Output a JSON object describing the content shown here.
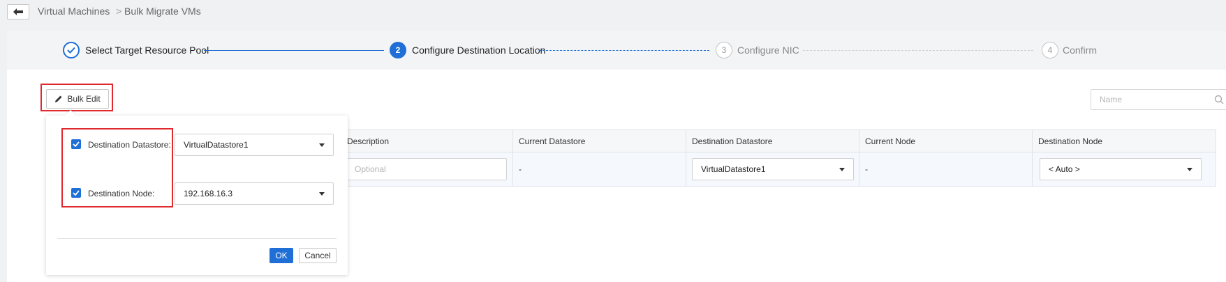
{
  "breadcrumb": {
    "parent": "Virtual Machines",
    "separator": ">",
    "current": "Bulk Migrate VMs"
  },
  "steps": [
    {
      "number": "",
      "label": "Select Target Resource Pool",
      "state": "done"
    },
    {
      "number": "2",
      "label": "Configure Destination Location",
      "state": "active"
    },
    {
      "number": "3",
      "label": "Configure NIC",
      "state": "pending"
    },
    {
      "number": "4",
      "label": "Confirm",
      "state": "pending"
    }
  ],
  "toolbar": {
    "bulk_edit_label": "Bulk Edit",
    "search_placeholder": "Name"
  },
  "table": {
    "columns": [
      "Description",
      "Current Datastore",
      "Destination Datastore",
      "Current Node",
      "Destination Node"
    ],
    "row": {
      "description_placeholder": "Optional",
      "current_datastore": "-",
      "destination_datastore": "VirtualDatastore1",
      "current_node": "-",
      "destination_node": "< Auto >"
    }
  },
  "bulk_edit_popover": {
    "datastore_label": "Destination Datastore:",
    "datastore_checked": true,
    "datastore_value": "VirtualDatastore1",
    "node_label": "Destination Node:",
    "node_checked": true,
    "node_value": "192.168.16.3",
    "ok_label": "OK",
    "cancel_label": "Cancel"
  },
  "colors": {
    "accent": "#1f6fd6",
    "highlight": "#e0292e"
  }
}
